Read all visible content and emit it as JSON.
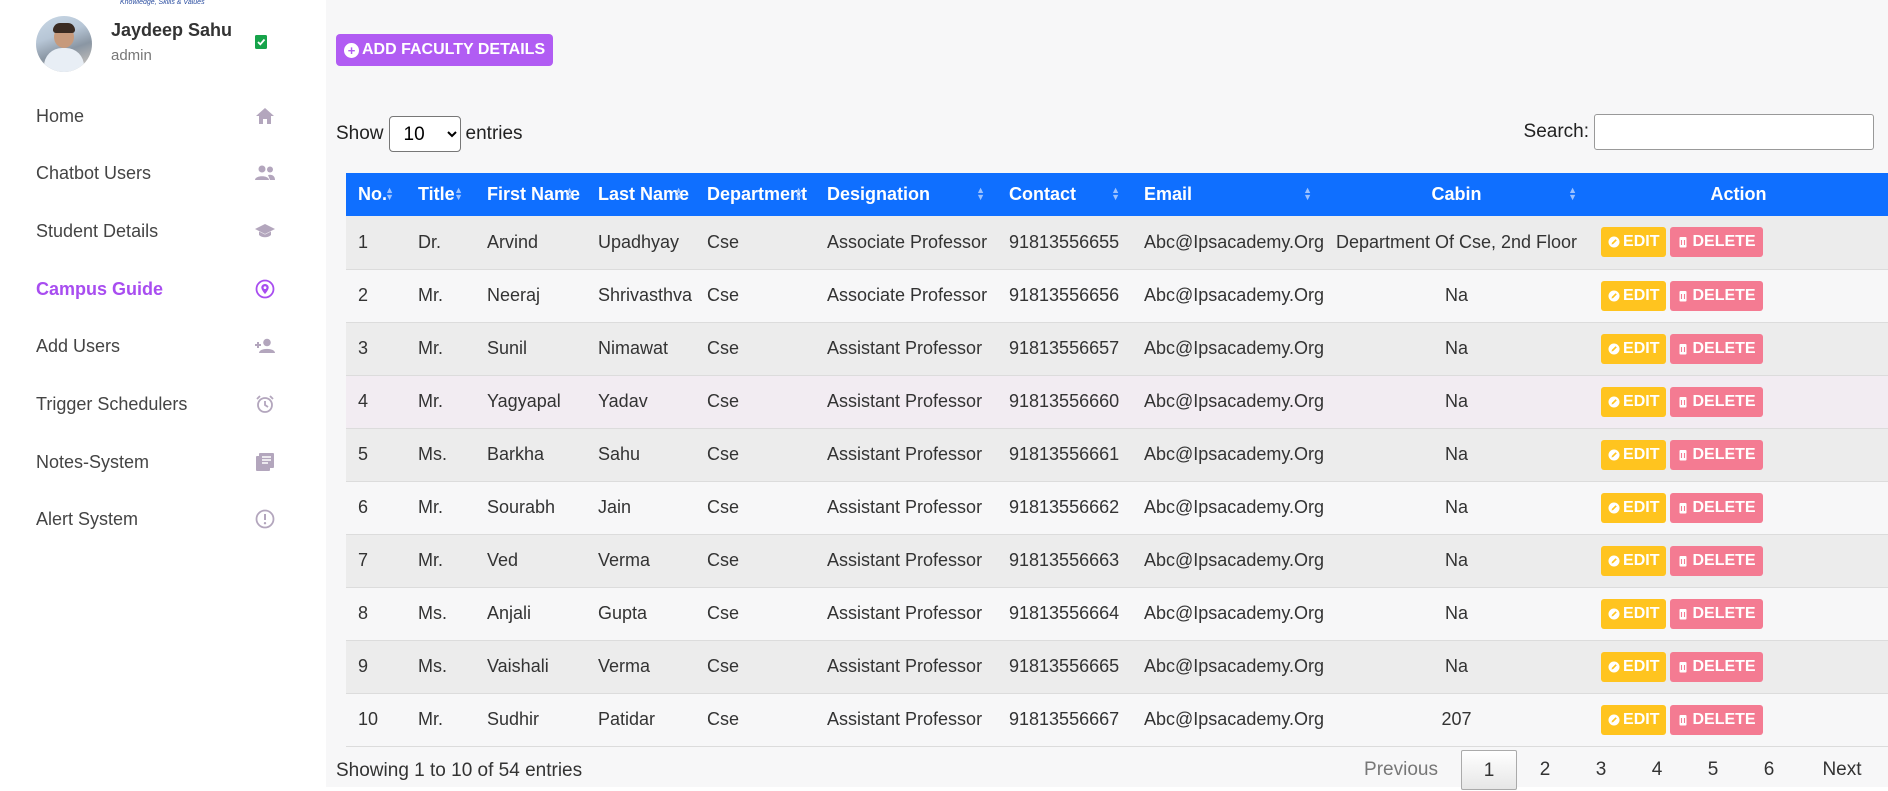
{
  "user": {
    "name": "Jaydeep Sahu",
    "role": "admin"
  },
  "logo_text": "Knowledge, Skills & Values",
  "sidebar": {
    "items": [
      {
        "label": "Home",
        "icon": "home-icon"
      },
      {
        "label": "Chatbot Users",
        "icon": "users-icon"
      },
      {
        "label": "Student Details",
        "icon": "graduation-cap-icon"
      },
      {
        "label": "Campus Guide",
        "icon": "location-pin-icon",
        "active": true
      },
      {
        "label": "Add Users",
        "icon": "add-user-icon"
      },
      {
        "label": "Trigger Schedulers",
        "icon": "alarm-clock-icon"
      },
      {
        "label": "Notes-System",
        "icon": "notes-icon"
      },
      {
        "label": "Alert System",
        "icon": "alert-icon"
      }
    ]
  },
  "colors": {
    "accent": "#b15cf3",
    "header": "#0f6fff",
    "edit": "#ffc41f",
    "delete": "#f47b92",
    "nav_icon": "#b3a6bd"
  },
  "toolbar": {
    "add_label": "ADD FACULTY DETAILS"
  },
  "length": {
    "show": "Show",
    "entries": "entries",
    "selected": "10"
  },
  "search": {
    "label": "Search:",
    "value": ""
  },
  "table": {
    "headers": [
      "No.",
      "Title",
      "First Name",
      "Last Name",
      "Department",
      "Designation",
      "Contact",
      "Email",
      "Cabin",
      "Action"
    ],
    "rows": [
      [
        "1",
        "Dr.",
        "Arvind",
        "Upadhyay",
        "Cse",
        "Associate Professor",
        "91813556655",
        "Abc@Ipsacademy.Org",
        "Department Of Cse, 2nd Floor"
      ],
      [
        "2",
        "Mr.",
        "Neeraj",
        "Shrivasthva",
        "Cse",
        "Associate Professor",
        "91813556656",
        "Abc@Ipsacademy.Org",
        "Na"
      ],
      [
        "3",
        "Mr.",
        "Sunil",
        "Nimawat",
        "Cse",
        "Assistant Professor",
        "91813556657",
        "Abc@Ipsacademy.Org",
        "Na"
      ],
      [
        "4",
        "Mr.",
        "Yagyapal",
        "Yadav",
        "Cse",
        "Assistant Professor",
        "91813556660",
        "Abc@Ipsacademy.Org",
        "Na"
      ],
      [
        "5",
        "Ms.",
        "Barkha",
        "Sahu",
        "Cse",
        "Assistant Professor",
        "91813556661",
        "Abc@Ipsacademy.Org",
        "Na"
      ],
      [
        "6",
        "Mr.",
        "Sourabh",
        "Jain",
        "Cse",
        "Assistant Professor",
        "91813556662",
        "Abc@Ipsacademy.Org",
        "Na"
      ],
      [
        "7",
        "Mr.",
        "Ved",
        "Verma",
        "Cse",
        "Assistant Professor",
        "91813556663",
        "Abc@Ipsacademy.Org",
        "Na"
      ],
      [
        "8",
        "Ms.",
        "Anjali",
        "Gupta",
        "Cse",
        "Assistant Professor",
        "91813556664",
        "Abc@Ipsacademy.Org",
        "Na"
      ],
      [
        "9",
        "Ms.",
        "Vaishali",
        "Verma",
        "Cse",
        "Assistant Professor",
        "91813556665",
        "Abc@Ipsacademy.Org",
        "Na"
      ],
      [
        "10",
        "Mr.",
        "Sudhir",
        "Patidar",
        "Cse",
        "Assistant Professor",
        "91813556667",
        "Abc@Ipsacademy.Org",
        "207"
      ]
    ],
    "edit_label": "EDIT",
    "delete_label": "DELETE"
  },
  "footer": {
    "info": "Showing 1 to 10 of 54 entries",
    "previous": "Previous",
    "next": "Next",
    "pages": [
      "1",
      "2",
      "3",
      "4",
      "5",
      "6"
    ],
    "current_page": "1"
  }
}
